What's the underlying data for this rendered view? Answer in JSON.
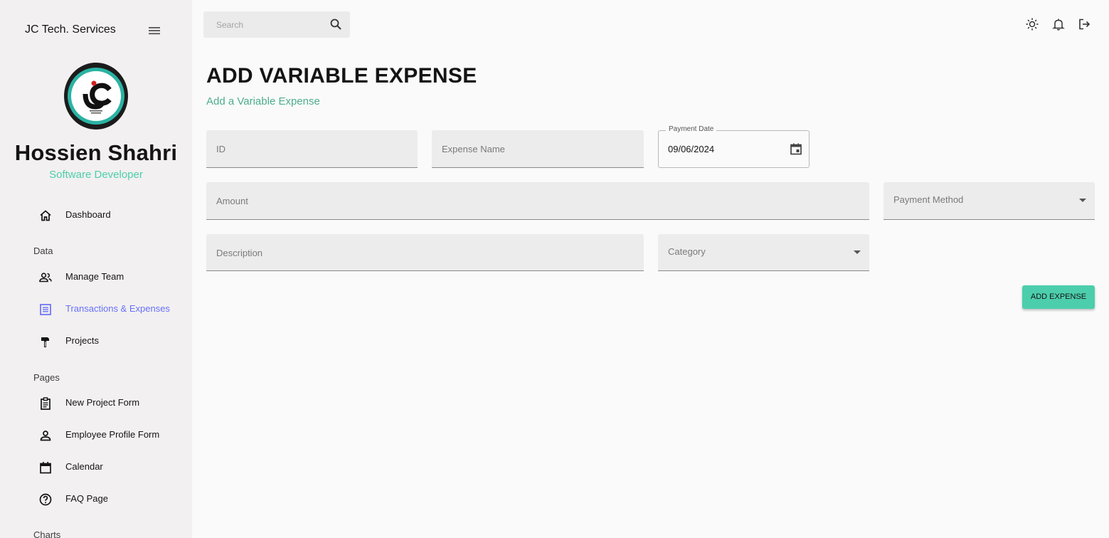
{
  "sidebar": {
    "brand": "JC Tech. Services",
    "user_name": "Hossien Shahri",
    "user_role": "Software Developer",
    "sections": {
      "data": "Data",
      "pages": "Pages",
      "charts": "Charts"
    },
    "items": {
      "dashboard": "Dashboard",
      "manage_team": "Manage Team",
      "transactions": "Transactions & Expenses",
      "projects": "Projects",
      "new_project": "New Project Form",
      "employee_profile": "Employee Profile Form",
      "calendar": "Calendar",
      "faq": "FAQ Page"
    },
    "active_item": "Transactions & Expenses"
  },
  "topbar": {
    "search_placeholder": "Search",
    "icons": [
      "search-icon",
      "light-mode-icon",
      "notifications-icon",
      "logout-icon"
    ]
  },
  "page": {
    "title": "ADD VARIABLE EXPENSE",
    "subtitle": "Add a Variable Expense"
  },
  "form": {
    "id_placeholder": "ID",
    "expense_name_placeholder": "Expense Name",
    "payment_date_label": "Payment Date",
    "payment_date_value": "09/06/2024",
    "amount_placeholder": "Amount",
    "payment_method_label": "Payment Method",
    "description_placeholder": "Description",
    "category_label": "Category",
    "submit_label": "ADD EXPENSE"
  },
  "colors": {
    "accent": "#4cceac",
    "active_nav": "#6870fa",
    "subtitle": "#4cae8e",
    "sidebar_bg": "#f2f0f0"
  }
}
